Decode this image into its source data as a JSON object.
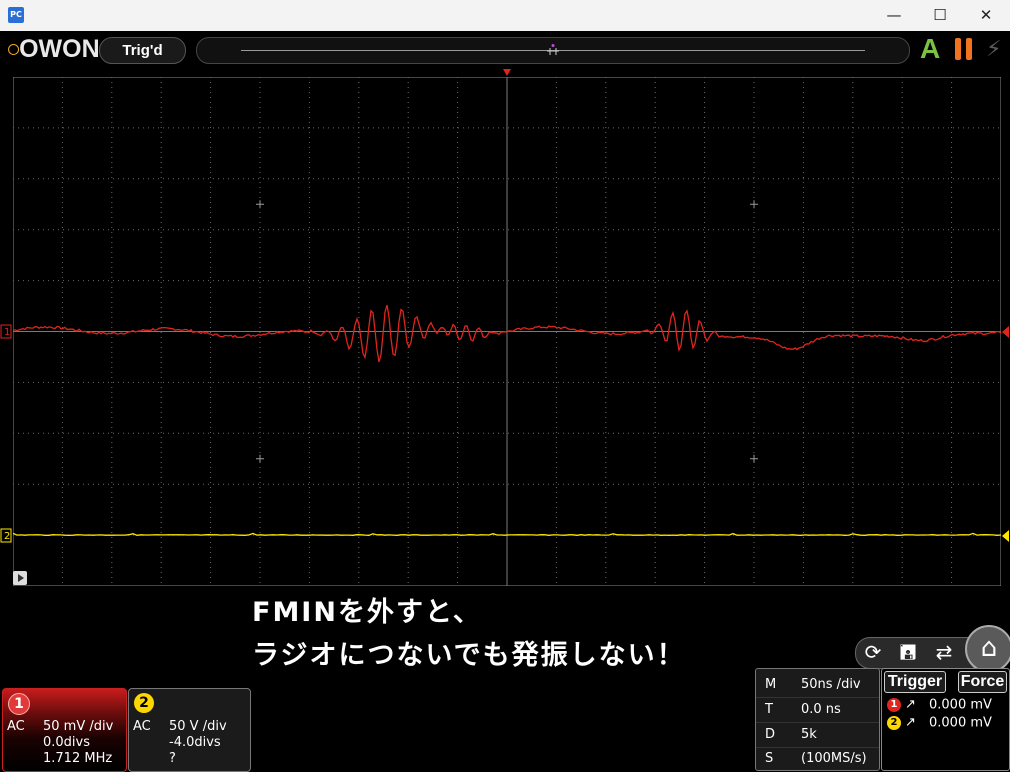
{
  "window": {
    "app_icon": "PC",
    "minimize_icon": "minimize-icon",
    "maximize_icon": "maximize-icon",
    "close_icon": "close-icon"
  },
  "toolbar": {
    "logo": "OWON",
    "trigger_status": "Trig'd",
    "auto_icon": "A",
    "pause_icon": "pause-icon",
    "force_icon": "bolt-icon"
  },
  "colors": {
    "ch1": "#e0241e",
    "ch2": "#ffe800",
    "grid": "#6a6a6a",
    "trigger_marker": "#e0241e"
  },
  "scope": {
    "h_divs": 20,
    "v_divs": 10,
    "ch1_marker": "1",
    "ch2_marker": "2"
  },
  "caption": {
    "line1": "FMINを外すと、",
    "line2": "ラジオにつないでも発振しない！"
  },
  "channels": [
    {
      "num": "1",
      "coupling": "AC",
      "scale": "50 mV /div",
      "offset": "0.0divs",
      "freq": "1.712 MHz"
    },
    {
      "num": "2",
      "coupling": "AC",
      "scale": "50 V /div",
      "offset": "-4.0divs",
      "freq": "?"
    }
  ],
  "timebase": {
    "m_key": "M",
    "m_val": "50ns /div",
    "t_key": "T",
    "t_val": "0.0 ns",
    "d_key": "D",
    "d_val": "5k",
    "s_key": "S",
    "s_val": "(100MS/s)"
  },
  "trigger": {
    "trigger_btn": "Trigger",
    "force_btn": "Force",
    "ch1_num": "1",
    "ch1_level": "0.000 mV",
    "ch2_num": "2",
    "ch2_level": "0.000 mV"
  },
  "controls": {
    "icons": [
      "refresh-icon",
      "save-icon",
      "swap-icon",
      "home-icon"
    ]
  }
}
